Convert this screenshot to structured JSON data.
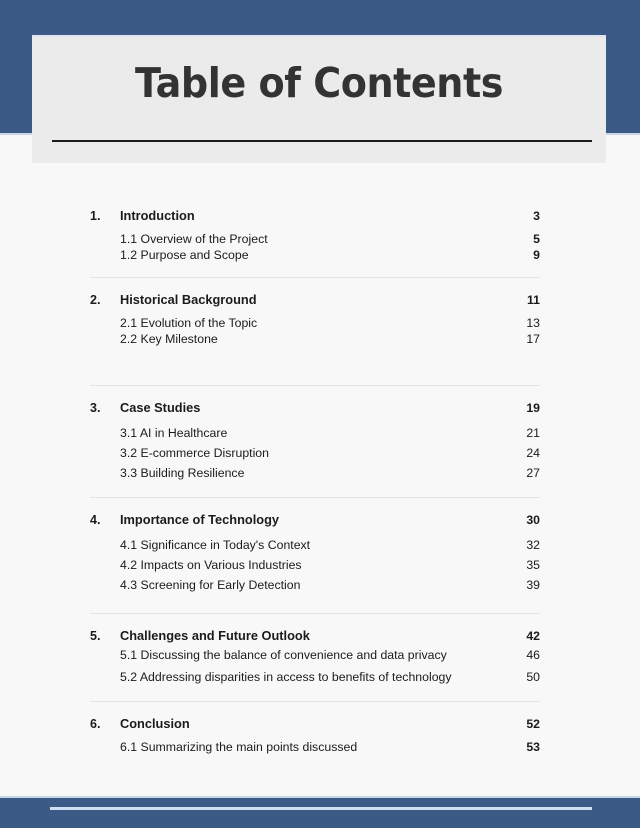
{
  "document": {
    "title": "Table of Contents",
    "accent_color": "#3b5a86",
    "card_color": "#ebebeb",
    "page_background": "#f8f8f9",
    "text_color": "#1b1b1b",
    "title_color": "#333333",
    "divider_color": "#e4e4e4",
    "footer_rule_color": "#cfe0f2"
  },
  "sections": [
    {
      "number": "1.",
      "title": "Introduction",
      "page": "3",
      "bold_subpages": true,
      "subsections": [
        {
          "label": "1.1 Overview of the Project",
          "page": "5"
        },
        {
          "label": "1.2 Purpose and Scope",
          "page": "9"
        }
      ]
    },
    {
      "number": "2.",
      "title": "Historical Background",
      "page": "11",
      "bold_subpages": false,
      "subsections": [
        {
          "label": "2.1 Evolution of the Topic",
          "page": "13"
        },
        {
          "label": "2.2 Key Milestone",
          "page": "17"
        }
      ]
    },
    {
      "number": "3.",
      "title": "Case Studies",
      "page": "19",
      "bold_subpages": false,
      "subsections": [
        {
          "label": "3.1 AI in Healthcare",
          "page": "21"
        },
        {
          "label": "3.2 E-commerce Disruption",
          "page": "24"
        },
        {
          "label": "3.3 Building Resilience",
          "page": "27"
        }
      ]
    },
    {
      "number": "4.",
      "title": "Importance of Technology",
      "page": "30",
      "bold_subpages": false,
      "subsections": [
        {
          "label": "4.1 Significance in Today's Context",
          "page": "32"
        },
        {
          "label": "4.2 Impacts on Various Industries",
          "page": "35"
        },
        {
          "label": "4.3 Screening for Early Detection",
          "page": "39"
        }
      ]
    },
    {
      "number": "5.",
      "title": "Challenges and Future Outlook",
      "page": "42",
      "bold_subpages": false,
      "subsections": [
        {
          "label": "5.1 Discussing the balance of convenience and data privacy",
          "page": "46"
        },
        {
          "label": "5.2 Addressing disparities in access to benefits of technology",
          "page": "50"
        }
      ]
    },
    {
      "number": "6.",
      "title": "Conclusion",
      "page": "52",
      "bold_subpages": true,
      "subsections": [
        {
          "label": "6.1 Summarizing the main points discussed",
          "page": "53"
        }
      ]
    }
  ]
}
